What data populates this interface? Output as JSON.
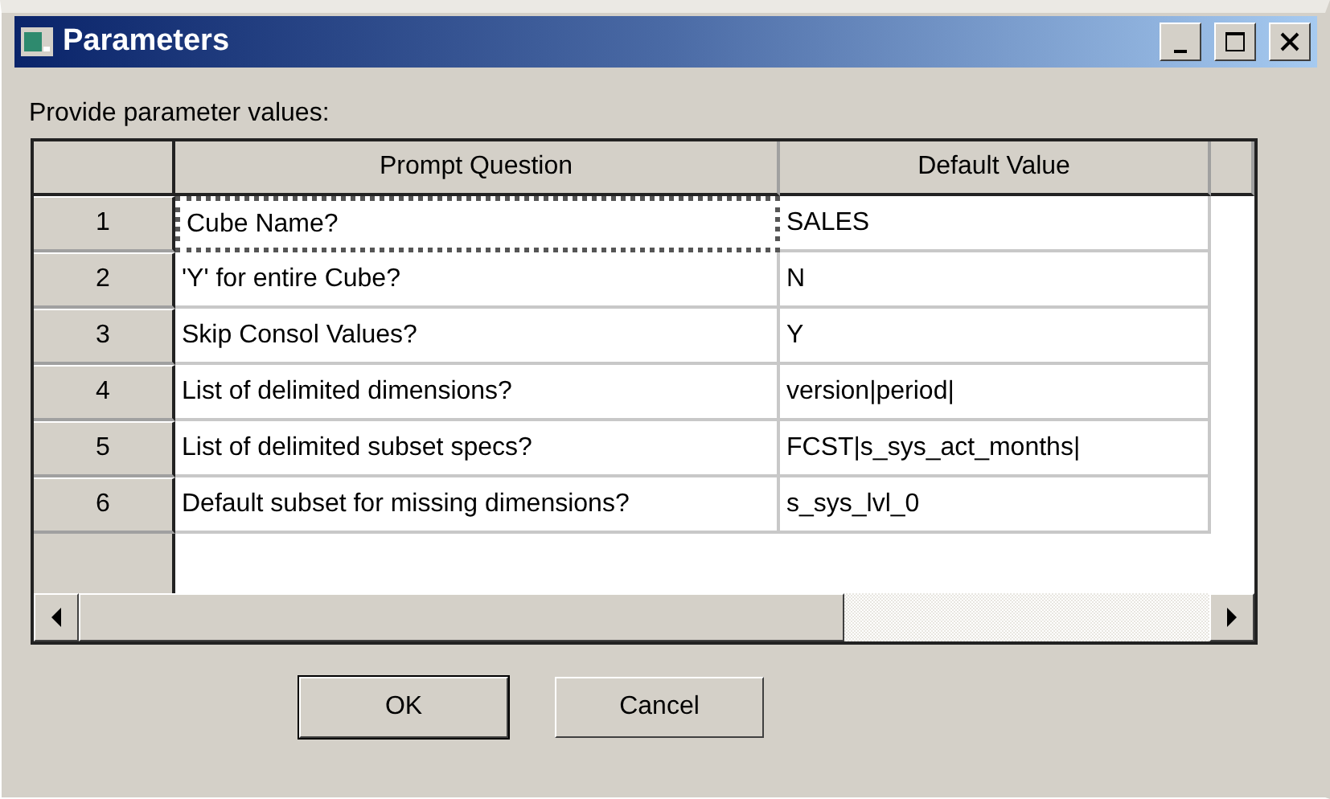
{
  "window": {
    "title": "Parameters"
  },
  "prompt": "Provide parameter values:",
  "table": {
    "columns": [
      "Prompt Question",
      "Default Value"
    ],
    "rows": [
      {
        "number": "1",
        "question": "Cube Name?",
        "value": "SALES",
        "focused": true
      },
      {
        "number": "2",
        "question": "'Y' for entire Cube?",
        "value": "N",
        "focused": false
      },
      {
        "number": "3",
        "question": "Skip Consol Values?",
        "value": "Y",
        "focused": false
      },
      {
        "number": "4",
        "question": "List of delimited dimensions?",
        "value": "version|period|",
        "focused": false
      },
      {
        "number": "5",
        "question": "List of delimited subset specs?",
        "value": "FCST|s_sys_act_months|",
        "focused": false
      },
      {
        "number": "6",
        "question": "Default subset for missing dimensions?",
        "value": "s_sys_lvl_0",
        "focused": false
      }
    ]
  },
  "buttons": [
    {
      "label": "OK",
      "default": true
    },
    {
      "label": "Cancel",
      "default": false
    }
  ]
}
